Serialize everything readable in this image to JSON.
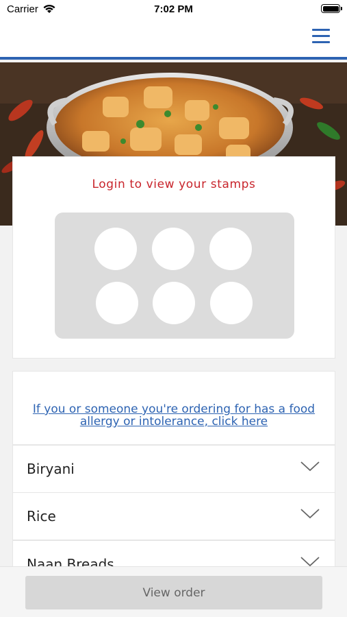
{
  "status_bar": {
    "carrier": "Carrier",
    "time": "7:02 PM"
  },
  "header": {
    "menu_icon": "hamburger-icon",
    "accent_color": "#2d63b2"
  },
  "hero": {
    "image": "curry-dish-photo"
  },
  "stamps": {
    "login_text": "Login to view your stamps",
    "stamp_count": 6
  },
  "allergy": {
    "link_text": "If you or someone you're ordering for has a food allergy or intolerance, click here"
  },
  "categories": [
    {
      "label": "Biryani"
    },
    {
      "label": "Rice"
    },
    {
      "label": "Naan Breads"
    }
  ],
  "footer": {
    "button_label": "View order"
  }
}
